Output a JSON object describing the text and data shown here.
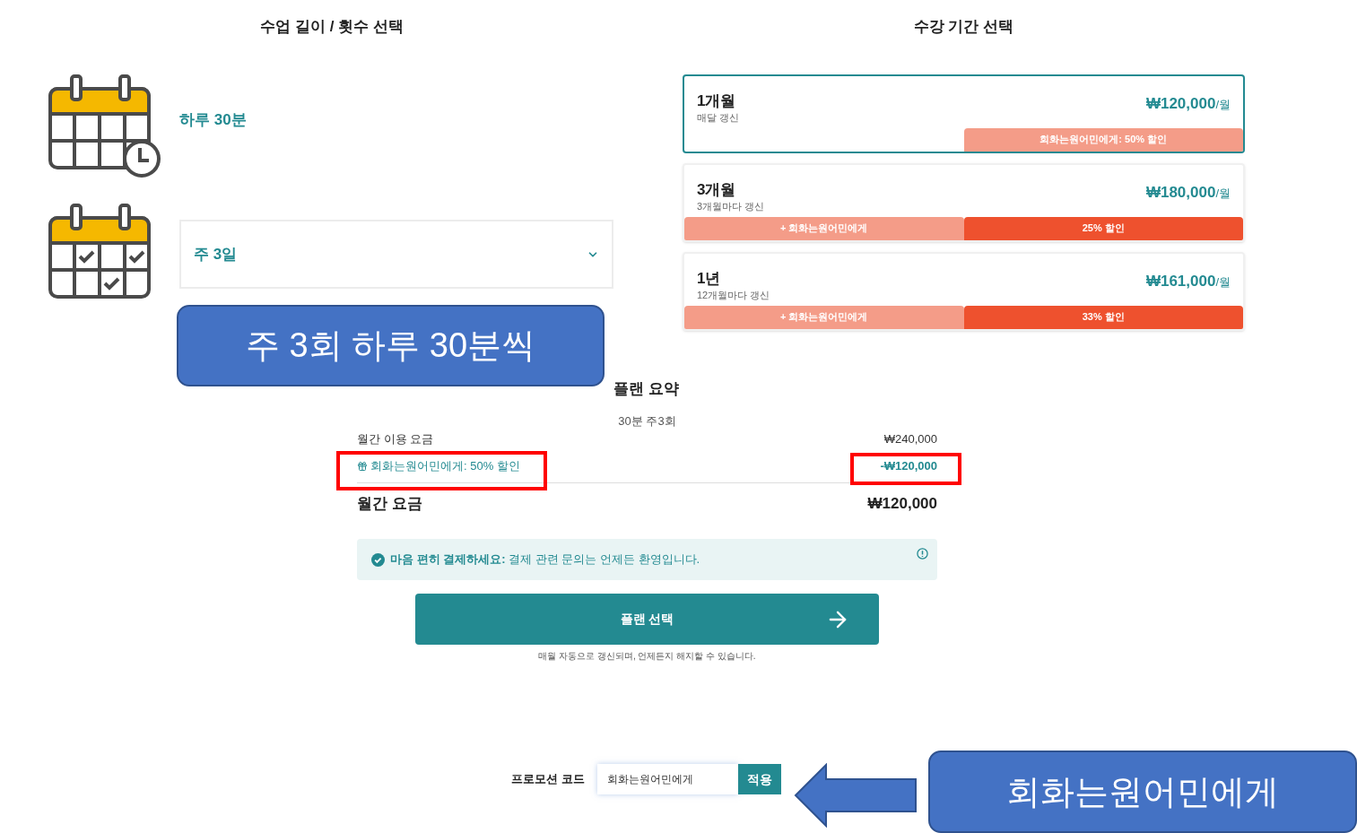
{
  "lesson": {
    "title": "수업 길이 / 횟수 선택",
    "options": [
      {
        "kind": "label",
        "text": "하루 30분"
      },
      {
        "kind": "select",
        "value": "주 3일"
      }
    ]
  },
  "period": {
    "title": "수강 기간 선택",
    "plans": [
      {
        "name": "1개월",
        "renewal": "매달 갱신",
        "price": "₩120,000",
        "unit": "/월",
        "selected": true,
        "badges": [
          {
            "kind": "promo",
            "text": "회화는원어민에게: 50% 할인"
          }
        ]
      },
      {
        "name": "3개월",
        "renewal": "3개월마다 갱신",
        "price": "₩180,000",
        "unit": "/월",
        "selected": false,
        "badges": [
          {
            "kind": "promo",
            "text": "+ 회화는원어민에게"
          },
          {
            "kind": "discount",
            "text": "25% 할인"
          }
        ]
      },
      {
        "name": "1년",
        "renewal": "12개월마다 갱신",
        "price": "₩161,000",
        "unit": "/월",
        "selected": false,
        "badges": [
          {
            "kind": "promo",
            "text": "+ 회화는원어민에게"
          },
          {
            "kind": "discount",
            "text": "33% 할인"
          }
        ]
      }
    ]
  },
  "summary": {
    "title": "플랜 요약",
    "subtitle": "30분 주3회",
    "rows": [
      {
        "kind": "base",
        "label": "월간 이용 요금",
        "value": "₩240,000"
      },
      {
        "kind": "discount",
        "label": "회화는원어민에게: 50% 할인",
        "value": "-₩120,000"
      }
    ],
    "total": {
      "label": "월간 요금",
      "value": "₩120,000"
    },
    "notice": "**마음 편히 결제하세요:** 결제 관련 문의는 언제든 환영입니다.",
    "button": "플랜 선택",
    "footnote": "매월 자동으로 갱신되며, 언제든지 해지할 수 있습니다."
  },
  "promo": {
    "label": "프로모션 코드",
    "value": "회화는원어민에게",
    "button": "적용"
  },
  "annotations": [
    {
      "kind": "callout",
      "text": "주 3회 하루 30분씩"
    },
    {
      "kind": "callout",
      "text": "회화는원어민에게"
    }
  ]
}
